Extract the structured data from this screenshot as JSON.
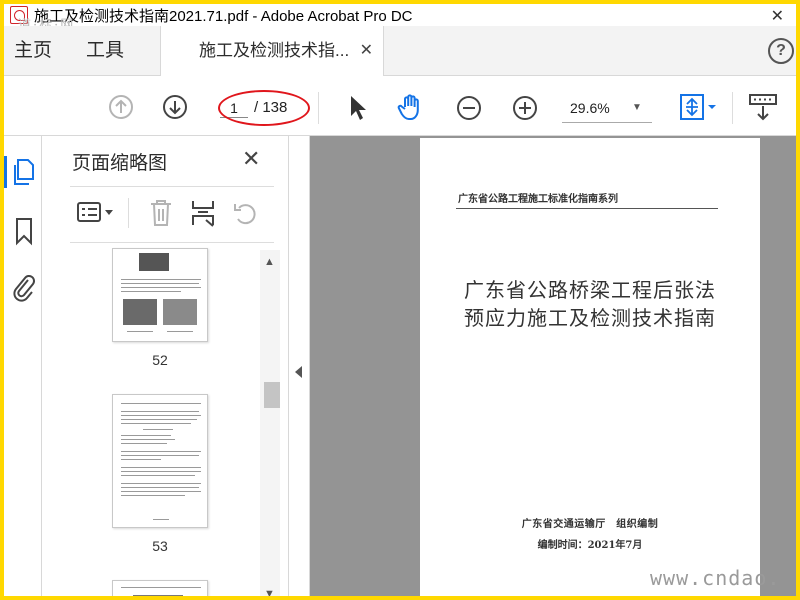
{
  "window": {
    "title": "施工及检测技术指南2021.71.pdf - Adobe Acrobat Pro DC",
    "close_glyph": "✕",
    "watermark_top": "道·标·网"
  },
  "nav": {
    "home_label": "主页",
    "tools_label": "工具",
    "document_tab_label": "施工及检测技术指...",
    "tab_close_glyph": "✕",
    "help_glyph": "?"
  },
  "toolbar": {
    "current_page": "1",
    "page_total": "/ 138",
    "zoom": "29.6%",
    "zoom_caret": "▼"
  },
  "thumbnails_panel": {
    "title": "页面缩略图",
    "close_glyph": "✕",
    "pages": [
      {
        "label": "52"
      },
      {
        "label": "53"
      }
    ],
    "scroll_up": "▲",
    "scroll_down": "▼"
  },
  "document": {
    "series_header": "广东省公路工程施工标准化指南系列",
    "title_line1": "广东省公路桥梁工程后张法",
    "title_line2": "预应力施工及检测技术指南",
    "organizer": "广东省交通运输厅　组织编制",
    "compile_date": "编制时间：2021年7月"
  },
  "watermark_bottom": "www.cndao.",
  "colors": {
    "frame": "#ffd800",
    "accent_blue": "#1473e6",
    "annotation_red": "#e0161c",
    "doc_background": "#949494"
  },
  "icons": {
    "rail": [
      "page-thumbnails-icon",
      "bookmark-icon",
      "paperclip-icon"
    ],
    "toolbar": [
      "previous-page-icon",
      "next-page-icon",
      "select-cursor-icon",
      "hand-tool-icon",
      "zoom-out-icon",
      "zoom-in-icon",
      "fit-page-icon",
      "scroll-mode-icon"
    ],
    "panel": [
      "options-icon",
      "delete-icon",
      "insert-page-icon",
      "rotate-icon"
    ]
  }
}
